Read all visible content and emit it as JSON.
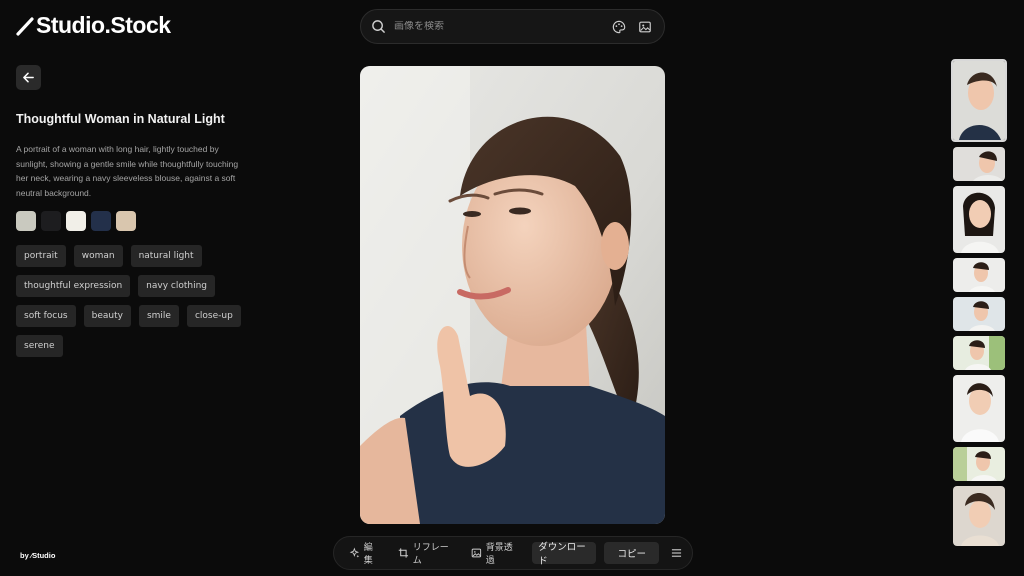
{
  "app": {
    "logo_text": "Studio.Stock"
  },
  "search": {
    "placeholder": "画像を検索"
  },
  "detail": {
    "title": "Thoughtful Woman in Natural Light",
    "description": "A portrait of a woman with long hair, lightly touched by sunlight, showing a gentle smile while thoughtfully touching her neck, wearing a navy sleeveless blouse, against a soft neutral background.",
    "palette": [
      "#c9c9bf",
      "#1d1d1f",
      "#f1efe8",
      "#23304a",
      "#d9c6ae"
    ],
    "tags": [
      "portrait",
      "woman",
      "natural light",
      "thoughtful expression",
      "navy clothing",
      "soft focus",
      "beauty",
      "smile",
      "close-up",
      "serene"
    ]
  },
  "toolbar": {
    "edit_label": "編集",
    "reframe_label": "リフレーム",
    "bg_remove_label": "背景透過",
    "download_label": "ダウンロード",
    "copy_label": "コピー"
  },
  "footer": {
    "by_label": "by ⁄Studio"
  },
  "icons": [
    "search-icon",
    "palette-icon",
    "image-icon",
    "arrow-left-icon",
    "sparkle-icon",
    "crop-icon",
    "image-remove-bg-icon",
    "menu-icon"
  ]
}
